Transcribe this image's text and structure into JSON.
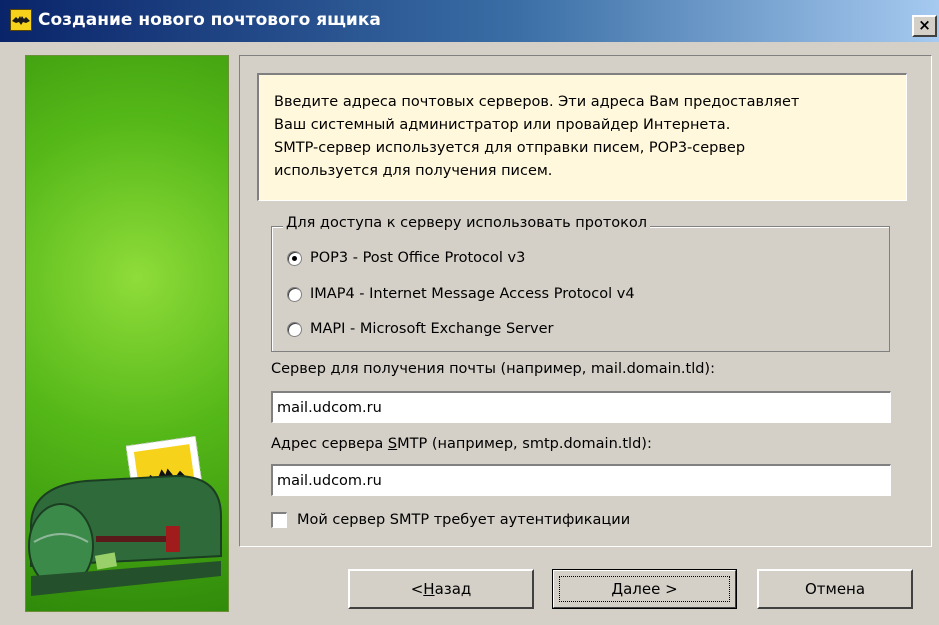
{
  "window": {
    "title": "Создание нового почтового ящика",
    "close_label": "×",
    "accent_color": "#0a246a",
    "panel_color": "#55b818",
    "info_background": "#fff8dc"
  },
  "info": {
    "lines": [
      "Введите адреса почтовых серверов. Эти адреса Вам предоставляет",
      "Ваш системный администратор или провайдер Интернета.",
      "SMTP-сервер используется для отправки писем, POP3-сервер",
      "используется для получения писем."
    ]
  },
  "protocol": {
    "legend": "Для доступа к серверу использовать протокол",
    "options": [
      {
        "label": "POP3 - Post Office Protocol v3",
        "checked": true
      },
      {
        "label": "IMAP4 - Internet Message Access Protocol v4",
        "checked": false
      },
      {
        "label": "MAPI - Microsoft Exchange Server",
        "checked": false
      }
    ]
  },
  "incoming": {
    "label": "Сервер для получения почты  (например, mail.domain.tld):",
    "value": "mail.udcom.ru"
  },
  "smtp": {
    "label_prefix": "Адрес сервера ",
    "label_access_key": "S",
    "label_suffix": "MTP (например, smtp.domain.tld):",
    "value": "mail.udcom.ru"
  },
  "auth": {
    "label": "Мой сервер SMTP требует аутентификации",
    "checked": false
  },
  "buttons": {
    "back_prefix": "< ",
    "back_key": "Н",
    "back_suffix": "азад",
    "next_key": "Д",
    "next_suffix": "алее  >",
    "cancel": "Отмена"
  },
  "icons": {
    "window": "bat-icon",
    "close": "close-icon",
    "illustration": "mailbox-icon"
  }
}
